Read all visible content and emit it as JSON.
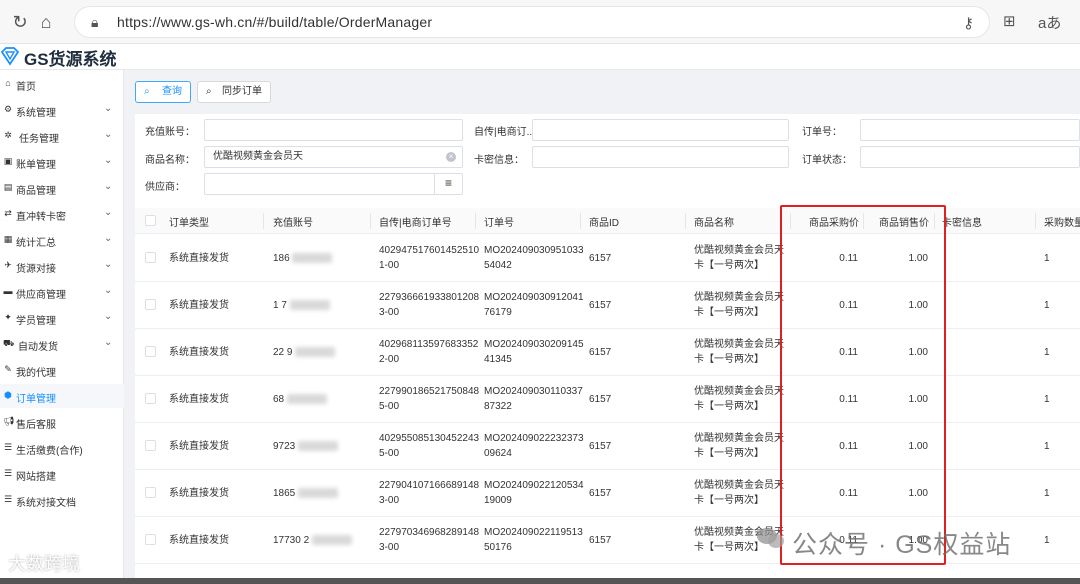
{
  "browser": {
    "url": "https://www.gs-wh.cn/#/build/table/OrderManager",
    "lang_icon": "aあ"
  },
  "app": {
    "title": "GS货源系统",
    "brand_color": "#1890ff"
  },
  "sidebar": {
    "items": [
      {
        "label": "首页",
        "icon": "home-icon"
      },
      {
        "label": "系统管理",
        "icon": "gears-icon"
      },
      {
        "label": "任务管理",
        "icon": "tasks-icon"
      },
      {
        "label": "账单管理",
        "icon": "bill-icon"
      },
      {
        "label": "商品管理",
        "icon": "goods-icon"
      },
      {
        "label": "直冲转卡密",
        "icon": "convert-icon"
      },
      {
        "label": "统计汇总",
        "icon": "stats-icon"
      },
      {
        "label": "货源对接",
        "icon": "source-icon"
      },
      {
        "label": "供应商管理",
        "icon": "supplier-icon"
      },
      {
        "label": "学员管理",
        "icon": "student-icon"
      },
      {
        "label": "自动发货",
        "icon": "car-icon"
      },
      {
        "label": "我的代理",
        "icon": "agent-icon"
      },
      {
        "label": "订单管理",
        "icon": "order-icon"
      },
      {
        "label": "售后客服",
        "icon": "service-icon"
      },
      {
        "label": "生活缴费(合作)",
        "icon": "list-icon"
      },
      {
        "label": "网站搭建",
        "icon": "list-icon"
      },
      {
        "label": "系统对接文档",
        "icon": "list-icon"
      }
    ]
  },
  "toolbar": {
    "query_label": "查询",
    "sync_label": "同步订单"
  },
  "filters": {
    "recharge_account_label": "充值账号：",
    "recharge_account_value": "",
    "ecom_order_label": "自传|电商订...",
    "ecom_order_value": "",
    "order_no_label": "订单号：",
    "order_no_value": "",
    "product_name_label": "商品名称：",
    "product_name_value": "优酷视频黄金会员天",
    "card_info_label": "卡密信息：",
    "card_info_value": "",
    "order_status_label": "订单状态：",
    "order_status_value": "",
    "supplier_label": "供应商：",
    "supplier_value": ""
  },
  "table": {
    "columns": [
      "订单类型",
      "充值账号",
      "自传|电商订单号",
      "订单号",
      "商品ID",
      "商品名称",
      "商品采购价",
      "商品销售价",
      "卡密信息",
      "采购数量"
    ],
    "rows": [
      {
        "type": "系统直接发货",
        "account": "186",
        "ecom1": "402947517601452510",
        "ecom2": "1-00",
        "order1": "MO202409030951033",
        "order2": "54042",
        "pid": "6157",
        "name1": "优酷视频黄金会员天",
        "name2": "卡【一号两次】",
        "buy": "0.11",
        "sell": "1.00",
        "card": "",
        "qty": "1"
      },
      {
        "type": "系统直接发货",
        "account": "1 7",
        "ecom1": "227936661933801208",
        "ecom2": "3-00",
        "order1": "MO202409030912041",
        "order2": "76179",
        "pid": "6157",
        "name1": "优酷视频黄金会员天",
        "name2": "卡【一号两次】",
        "buy": "0.11",
        "sell": "1.00",
        "card": "",
        "qty": "1"
      },
      {
        "type": "系统直接发货",
        "account": "22 9",
        "ecom1": "402968113597683352",
        "ecom2": "2-00",
        "order1": "MO202409030209145",
        "order2": "41345",
        "pid": "6157",
        "name1": "优酷视频黄金会员天",
        "name2": "卡【一号两次】",
        "buy": "0.11",
        "sell": "1.00",
        "card": "",
        "qty": "1"
      },
      {
        "type": "系统直接发货",
        "account": "68",
        "ecom1": "227990186521750848",
        "ecom2": "5-00",
        "order1": "MO202409030110337",
        "order2": "87322",
        "pid": "6157",
        "name1": "优酷视频黄金会员天",
        "name2": "卡【一号两次】",
        "buy": "0.11",
        "sell": "1.00",
        "card": "",
        "qty": "1"
      },
      {
        "type": "系统直接发货",
        "account": "9723",
        "ecom1": "402955085130452243",
        "ecom2": "5-00",
        "order1": "MO202409022232373",
        "order2": "09624",
        "pid": "6157",
        "name1": "优酷视频黄金会员天",
        "name2": "卡【一号两次】",
        "buy": "0.11",
        "sell": "1.00",
        "card": "",
        "qty": "1"
      },
      {
        "type": "系统直接发货",
        "account": "1865",
        "ecom1": "227904107166689148",
        "ecom2": "3-00",
        "order1": "MO202409022120534",
        "order2": "19009",
        "pid": "6157",
        "name1": "优酷视频黄金会员天",
        "name2": "卡【一号两次】",
        "buy": "0.11",
        "sell": "1.00",
        "card": "",
        "qty": "1"
      },
      {
        "type": "系统直接发货",
        "account": "17730 2",
        "ecom1": "227970346968289148",
        "ecom2": "3-00",
        "order1": "MO202409022119513",
        "order2": "50176",
        "pid": "6157",
        "name1": "优酷视频黄金会员天",
        "name2": "卡【一号两次】",
        "buy": "0.11",
        "sell": "1.00",
        "card": "",
        "qty": "1"
      }
    ]
  },
  "watermarks": {
    "main": "公众号 · GS权益站",
    "corner": "大数跨境"
  }
}
